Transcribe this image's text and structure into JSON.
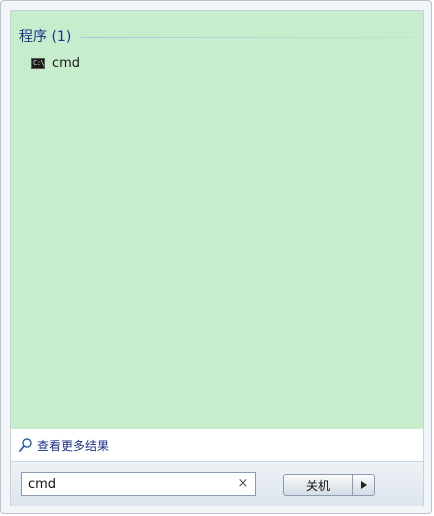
{
  "results_panel": {
    "group_title": "程序 (1)",
    "items": [
      {
        "label": "cmd",
        "icon": "command-prompt-icon"
      }
    ]
  },
  "more_results": {
    "label": "查看更多结果",
    "icon": "search-icon"
  },
  "search": {
    "value": "cmd",
    "clear_glyph": "×"
  },
  "power": {
    "shutdown_label": "关机",
    "arrow_icon": "triangle-right-icon"
  },
  "colors": {
    "results_background": "#c8edcc",
    "group_title": "#1e3287",
    "link_text": "#1e3287"
  }
}
